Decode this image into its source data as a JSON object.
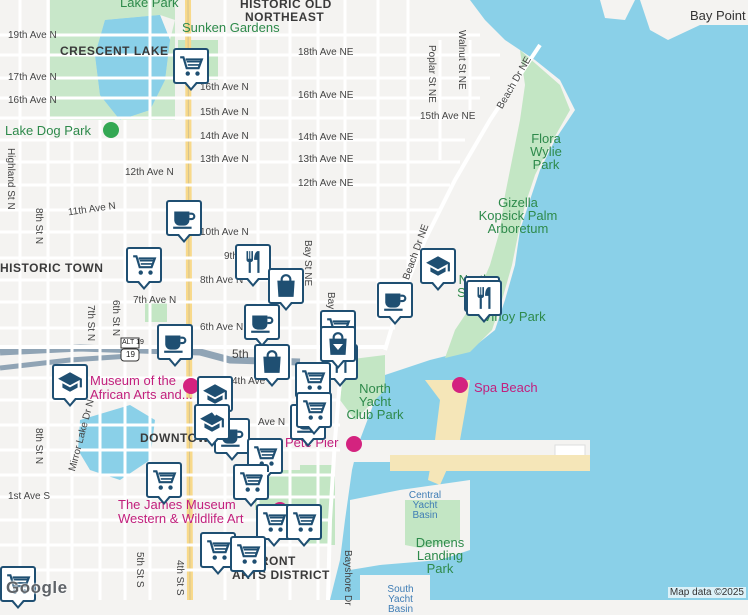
{
  "attribution": "Map data ©2025",
  "logo": "Google",
  "neighborhoods": {
    "historic_old_northeast_1": "HISTORIC OLD",
    "historic_old_northeast_2": "NORTHEAST",
    "crescent_lake": "CRESCENT LAKE",
    "downtown": "DOWNTOWN",
    "historic_town": "HISTORIC TOWN",
    "front_arts_1": "FRONT",
    "front_arts_2": "ARTS DISTRICT"
  },
  "places": {
    "lake_park": "Lake Park",
    "sunken_gardens": "Sunken Gardens",
    "lake_dog_park": "Lake Dog Park",
    "flora_wylie_park": "Flora Wylie Park",
    "gizella_kopsick": "Gizella Kopsick Palm Arboretum",
    "vinoy_park": "Vinoy Park",
    "north_shore": "North Shore",
    "north_yacht_club_park": "North Yacht Club Park",
    "spa_beach": "Spa Beach",
    "pete_pier": "Pete Pier",
    "museum_african_1": "Museum of the",
    "museum_african_2": "African Arts and...",
    "james_museum_1": "The James Museum",
    "james_museum_2": "Western & Wildlife Art",
    "central_yacht_basin": "Central Yacht Basin",
    "demens_landing": "Demens Landing Park",
    "south_yacht_basin": "South Yacht Basin",
    "bay_point": "Bay Point"
  },
  "streets": {
    "s19th_ave_n": "19th Ave N",
    "s17th_ave_n": "17th Ave N",
    "s16th_ave_n": "16th Ave N",
    "s15th_ave_n": "15th Ave N",
    "s14th_ave_n": "14th Ave N",
    "s13th_ave_n": "13th Ave N",
    "s12th_ave_n": "12th Ave N",
    "s11th_ave_n": "11th Ave N",
    "s10th_ave_n": "10th Ave N",
    "s9th_ave_n": "9th",
    "s8th_ave_n": "8th Ave N",
    "s7th_ave_n": "7th Ave N",
    "s6th_ave_n": "6th Ave N",
    "s5th_ave_n": "5th",
    "s4th_ave_n": "4th Ave N",
    "s3rd_ave_n": "Ave N",
    "s1st_ave_s": "1st Ave S",
    "s18th_ave_ne": "18th Ave NE",
    "s16th_ave_ne": "16th Ave NE",
    "s15th_ave_ne": "15th Ave NE",
    "s14th_ave_ne": "14th Ave NE",
    "s13th_ave_ne": "13th Ave NE",
    "s12th_ave_ne": "12th Ave NE",
    "bay_st_ne": "Bay St NE",
    "beach_dr_ne": "Beach Dr NE",
    "beach_dr_ne_2": "Beach Dr NE",
    "walnut_st_ne": "Walnut St NE",
    "poplar_st_ne": "Poplar St NE",
    "highland_st_n": "Highland St N",
    "s8th_st_n": "8th St N",
    "s8th_st_n_2": "8th St N",
    "s7th_st_n": "7th St N",
    "s6th_st_n": "6th St N",
    "s5th_st_s": "5th St S",
    "s4th_st_s": "4th St S",
    "mirror_lake_dr": "Mirror Lake Dr N",
    "bayshore": "Bayshore Dr",
    "bay_st_short": "Bay",
    "alt_19": "ALT 19",
    "route_19": "19"
  },
  "colors": {
    "water": "#8ad0e8",
    "park": "#c3e6c4",
    "land": "#f4f3f1",
    "road": "#ffffff",
    "highway": "#90a4b5",
    "pin_border": "#1f4f72",
    "poi": "#d4237f"
  },
  "markers": [
    {
      "type": "grocery",
      "name": "grocery-marker"
    },
    {
      "type": "cafe",
      "name": "cafe-marker"
    },
    {
      "type": "grocery",
      "name": "grocery-marker"
    },
    {
      "type": "restaurant",
      "name": "restaurant-marker"
    },
    {
      "type": "shopping",
      "name": "shopping-marker"
    },
    {
      "type": "cafe",
      "name": "cafe-marker"
    },
    {
      "type": "cafe",
      "name": "cafe-marker"
    },
    {
      "type": "school",
      "name": "school-marker"
    },
    {
      "type": "restaurant",
      "name": "restaurant-marker"
    },
    {
      "type": "cafe",
      "name": "cafe-marker"
    },
    {
      "type": "grocery",
      "name": "grocery-marker"
    },
    {
      "type": "restaurant",
      "name": "restaurant-marker"
    },
    {
      "type": "shopping",
      "name": "shopping-marker"
    },
    {
      "type": "restaurant",
      "name": "restaurant-marker"
    },
    {
      "type": "shopping",
      "name": "shopping-marker"
    },
    {
      "type": "school",
      "name": "school-marker"
    },
    {
      "type": "school",
      "name": "school-marker"
    },
    {
      "type": "grocery",
      "name": "grocery-marker"
    },
    {
      "type": "cafe",
      "name": "cafe-marker"
    },
    {
      "type": "cafe",
      "name": "cafe-marker"
    },
    {
      "type": "grocery",
      "name": "grocery-marker"
    },
    {
      "type": "grocery",
      "name": "grocery-marker"
    },
    {
      "type": "grocery",
      "name": "grocery-marker"
    },
    {
      "type": "grocery",
      "name": "grocery-marker"
    },
    {
      "type": "grocery",
      "name": "grocery-marker"
    },
    {
      "type": "grocery",
      "name": "grocery-marker"
    },
    {
      "type": "grocery",
      "name": "grocery-marker"
    },
    {
      "type": "grocery",
      "name": "grocery-marker"
    },
    {
      "type": "school",
      "name": "school-marker"
    },
    {
      "type": "grocery",
      "name": "grocery-marker"
    }
  ]
}
